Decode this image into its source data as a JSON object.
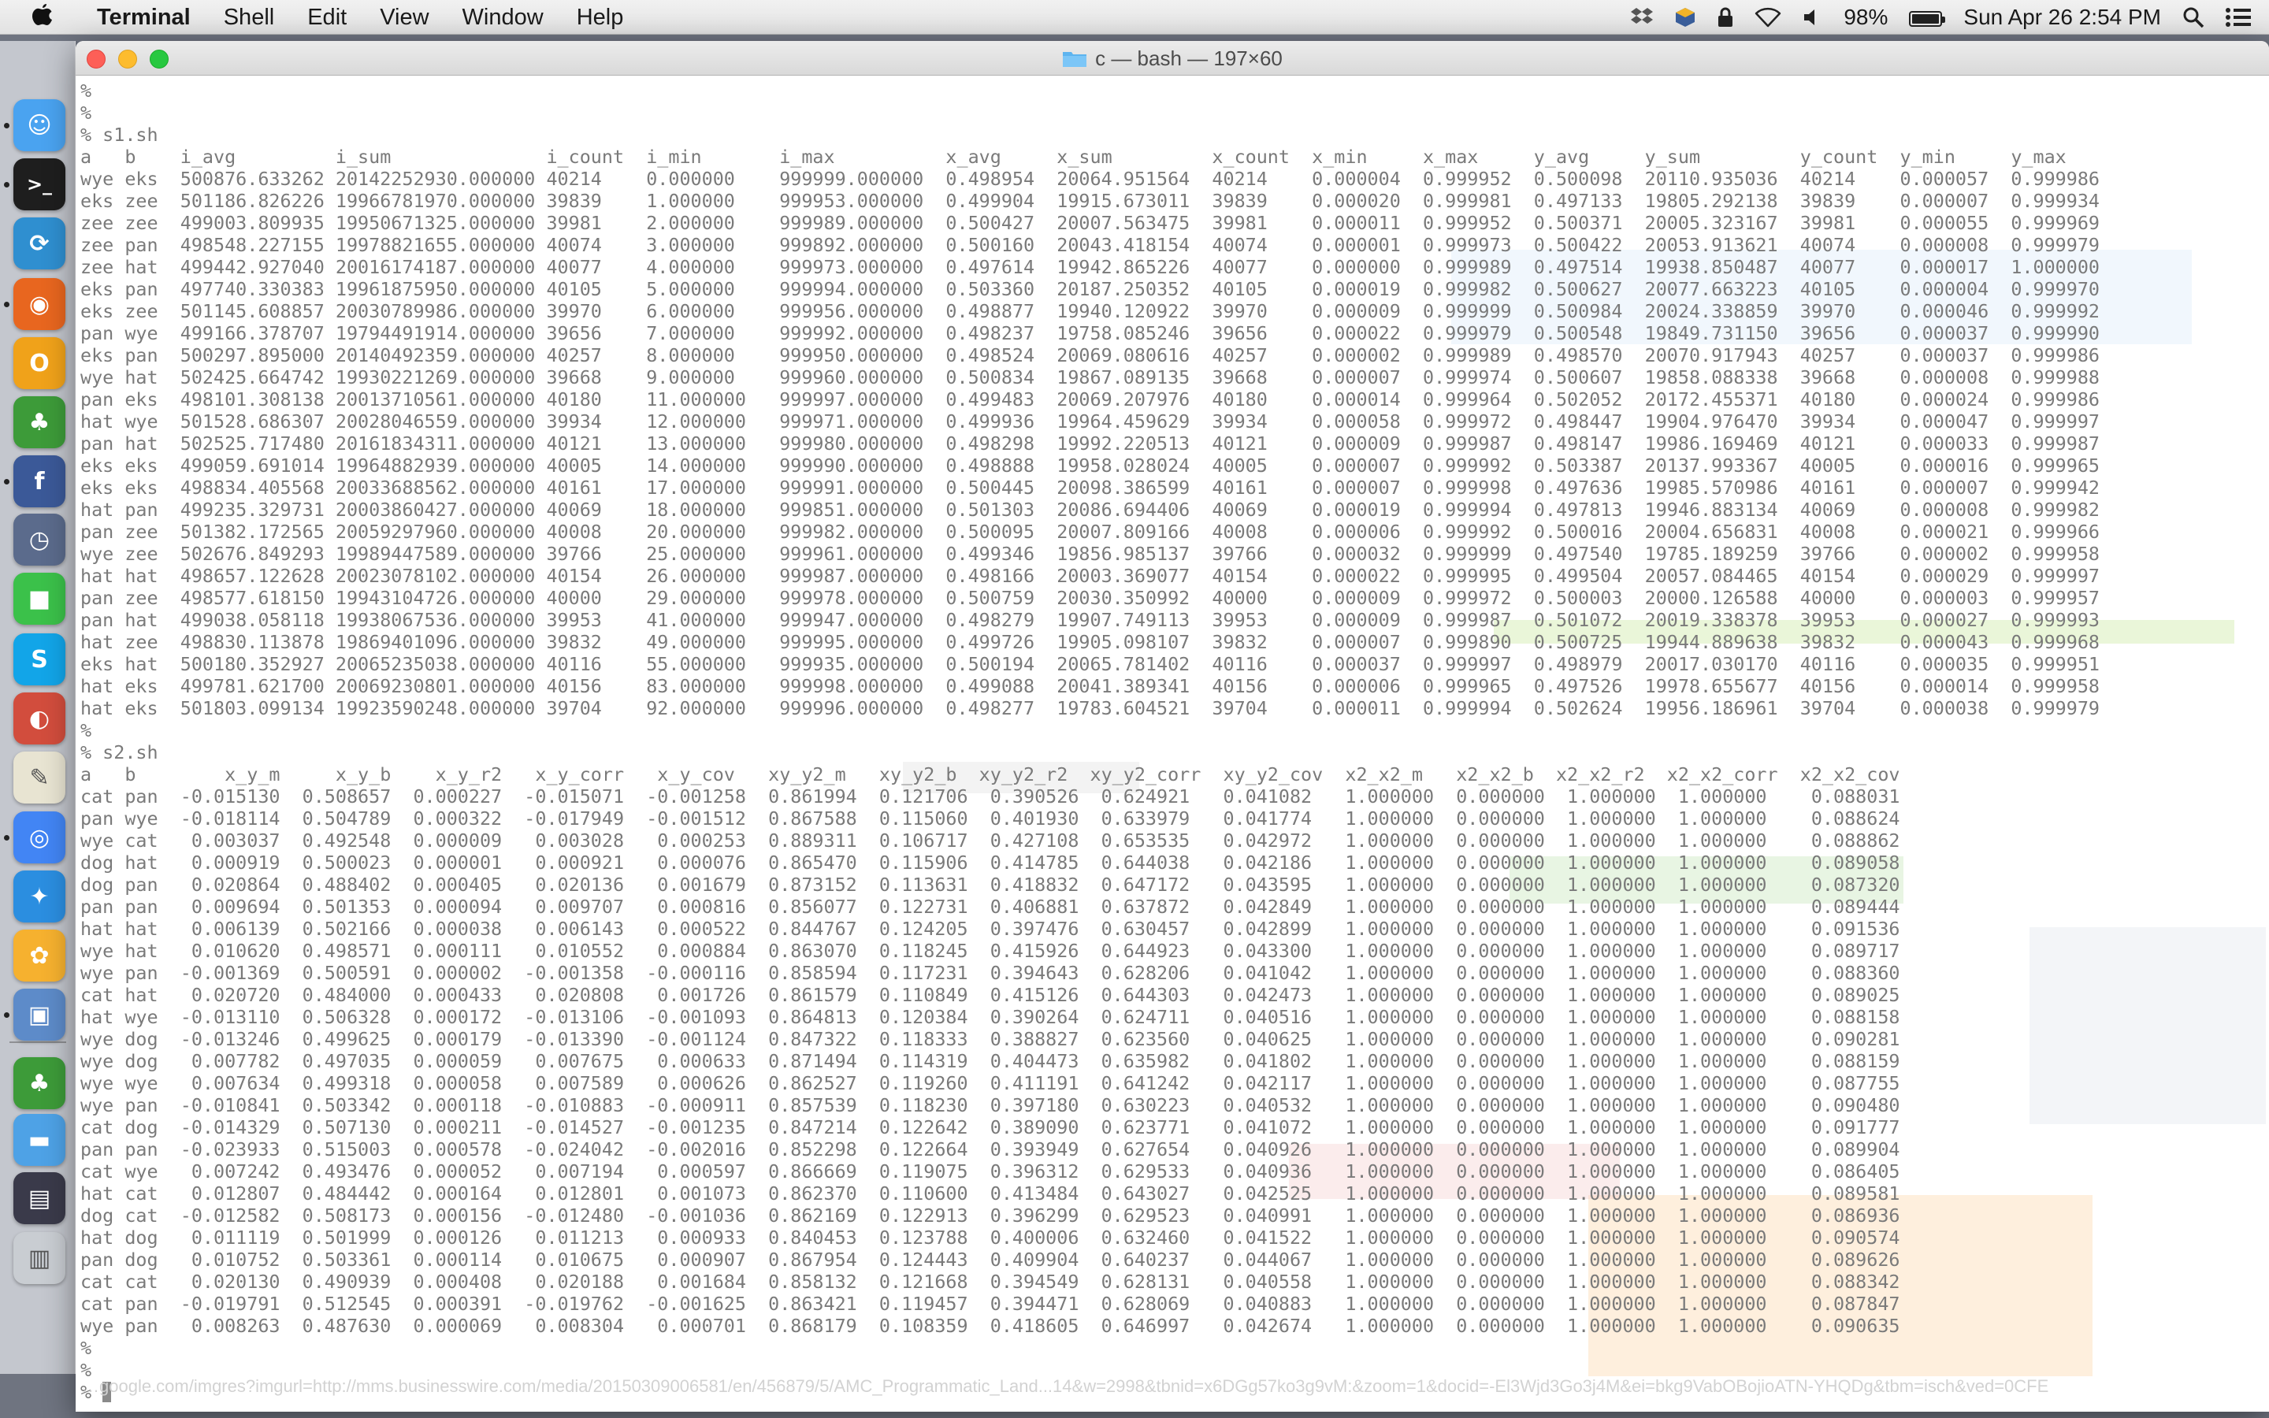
{
  "menubar": {
    "app": "Terminal",
    "items": [
      "Shell",
      "Edit",
      "View",
      "Window",
      "Help"
    ],
    "battery_percent": "98%",
    "battery_level": 0.98,
    "clock": "Sun Apr 26  2:54 PM"
  },
  "window": {
    "title": "c — bash — 197×60"
  },
  "terminal": {
    "lines": [
      "%",
      "%",
      "% s1.sh",
      "a   b    i_avg         i_sum              i_count  i_min       i_max          x_avg     x_sum         x_count  x_min     x_max     y_avg     y_sum         y_count  y_min     y_max",
      "wye eks  500876.633262 20142252930.000000 40214    0.000000    999999.000000  0.498954  20064.951564  40214    0.000004  0.999952  0.500098  20110.935036  40214    0.000057  0.999986",
      "eks zee  501186.826226 19966781970.000000 39839    1.000000    999953.000000  0.499904  19915.673011  39839    0.000020  0.999981  0.497133  19805.292138  39839    0.000007  0.999934",
      "zee zee  499003.809935 19950671325.000000 39981    2.000000    999989.000000  0.500427  20007.563475  39981    0.000011  0.999952  0.500371  20005.323167  39981    0.000055  0.999969",
      "zee pan  498548.227155 19978821655.000000 40074    3.000000    999892.000000  0.500160  20043.418154  40074    0.000001  0.999973  0.500422  20053.913621  40074    0.000008  0.999979",
      "zee hat  499442.927040 20016174187.000000 40077    4.000000    999973.000000  0.497614  19942.865226  40077    0.000000  0.999989  0.497514  19938.850487  40077    0.000017  1.000000",
      "eks pan  497740.330383 19961875950.000000 40105    5.000000    999994.000000  0.503360  20187.250352  40105    0.000019  0.999982  0.500627  20077.663223  40105    0.000004  0.999970",
      "eks zee  501145.608857 20030789986.000000 39970    6.000000    999956.000000  0.498877  19940.120922  39970    0.000009  0.999999  0.500984  20024.338859  39970    0.000046  0.999992",
      "pan wye  499166.378707 19794491914.000000 39656    7.000000    999992.000000  0.498237  19758.085246  39656    0.000022  0.999979  0.500548  19849.731150  39656    0.000037  0.999990",
      "eks pan  500297.895000 20140492359.000000 40257    8.000000    999950.000000  0.498524  20069.080616  40257    0.000002  0.999989  0.498570  20070.917943  40257    0.000037  0.999986",
      "wye hat  502425.664742 19930221269.000000 39668    9.000000    999960.000000  0.500834  19867.089135  39668    0.000007  0.999974  0.500607  19858.088338  39668    0.000008  0.999988",
      "pan eks  498101.308138 20013710561.000000 40180    11.000000   999997.000000  0.499483  20069.207976  40180    0.000014  0.999964  0.502052  20172.455371  40180    0.000024  0.999986",
      "hat wye  501528.686307 20028046559.000000 39934    12.000000   999971.000000  0.499936  19964.459629  39934    0.000058  0.999972  0.498447  19904.976470  39934    0.000047  0.999997",
      "pan hat  502525.717480 20161834311.000000 40121    13.000000   999980.000000  0.498298  19992.220513  40121    0.000009  0.999987  0.498147  19986.169469  40121    0.000033  0.999987",
      "eks eks  499059.691014 19964882939.000000 40005    14.000000   999990.000000  0.498888  19958.028024  40005    0.000007  0.999992  0.503387  20137.993367  40005    0.000016  0.999965",
      "eks eks  498834.405568 20033688562.000000 40161    17.000000   999991.000000  0.500445  20098.386599  40161    0.000007  0.999998  0.497636  19985.570986  40161    0.000007  0.999942",
      "hat pan  499235.329731 20003860427.000000 40069    18.000000   999851.000000  0.501303  20086.694406  40069    0.000019  0.999994  0.497813  19946.883134  40069    0.000008  0.999982",
      "pan zee  501382.172565 20059297960.000000 40008    20.000000   999982.000000  0.500095  20007.809166  40008    0.000006  0.999992  0.500016  20004.656831  40008    0.000021  0.999966",
      "wye zee  502676.849293 19989447589.000000 39766    25.000000   999961.000000  0.499346  19856.985137  39766    0.000032  0.999999  0.497540  19785.189259  39766    0.000002  0.999958",
      "hat hat  498657.122628 20023078102.000000 40154    26.000000   999987.000000  0.498166  20003.369077  40154    0.000022  0.999995  0.499504  20057.084465  40154    0.000029  0.999997",
      "pan zee  498577.618150 19943104726.000000 40000    29.000000   999978.000000  0.500759  20030.350992  40000    0.000009  0.999972  0.500003  20000.126588  40000    0.000003  0.999957",
      "pan hat  499038.058118 19938067536.000000 39953    41.000000   999947.000000  0.498279  19907.749113  39953    0.000009  0.999987  0.501072  20019.338378  39953    0.000027  0.999993",
      "hat zee  498830.113878 19869401096.000000 39832    49.000000   999995.000000  0.499726  19905.098107  39832    0.000007  0.999890  0.500725  19944.889638  39832    0.000043  0.999968",
      "eks hat  500180.352927 20065235038.000000 40116    55.000000   999935.000000  0.500194  20065.781402  40116    0.000037  0.999997  0.498979  20017.030170  40116    0.000035  0.999951",
      "hat eks  499781.621700 20069230801.000000 40156    83.000000   999998.000000  0.499088  20041.389341  40156    0.000006  0.999965  0.497526  19978.655677  40156    0.000014  0.999958",
      "hat eks  501803.099134 19923590248.000000 39704    92.000000   999996.000000  0.498277  19783.604521  39704    0.000011  0.999994  0.502624  19956.186961  39704    0.000038  0.999979",
      "%",
      "% s2.sh",
      "a   b        x_y_m     x_y_b    x_y_r2   x_y_corr   x_y_cov   xy_y2_m   xy_y2_b  xy_y2_r2  xy_y2_corr  xy_y2_cov  x2_x2_m   x2_x2_b  x2_x2_r2  x2_x2_corr  x2_x2_cov",
      "cat pan  -0.015130  0.508657  0.000227  -0.015071  -0.001258  0.861994  0.121706  0.390526  0.624921   0.041082   1.000000  0.000000  1.000000  1.000000    0.088031",
      "pan wye  -0.018114  0.504789  0.000322  -0.017949  -0.001512  0.867588  0.115060  0.401930  0.633979   0.041774   1.000000  0.000000  1.000000  1.000000    0.088624",
      "wye cat   0.003037  0.492548  0.000009   0.003028   0.000253  0.889311  0.106717  0.427108  0.653535   0.042972   1.000000  0.000000  1.000000  1.000000    0.088862",
      "dog hat   0.000919  0.500023  0.000001   0.000921   0.000076  0.865470  0.115906  0.414785  0.644038   0.042186   1.000000  0.000000  1.000000  1.000000    0.089058",
      "dog pan   0.020864  0.488402  0.000405   0.020136   0.001679  0.873152  0.113631  0.418832  0.647172   0.043595   1.000000  0.000000  1.000000  1.000000    0.087320",
      "pan pan   0.009694  0.501353  0.000094   0.009707   0.000816  0.856077  0.122731  0.406881  0.637872   0.042849   1.000000  0.000000  1.000000  1.000000    0.089444",
      "hat hat   0.006139  0.502166  0.000038   0.006143   0.000522  0.844767  0.124205  0.397476  0.630457   0.042899   1.000000  0.000000  1.000000  1.000000    0.091536",
      "wye hat   0.010620  0.498571  0.000111   0.010552   0.000884  0.863070  0.118245  0.415926  0.644923   0.043300   1.000000  0.000000  1.000000  1.000000    0.089717",
      "wye pan  -0.001369  0.500591  0.000002  -0.001358  -0.000116  0.858594  0.117231  0.394643  0.628206   0.041042   1.000000  0.000000  1.000000  1.000000    0.088360",
      "cat hat   0.020720  0.484000  0.000433   0.020808   0.001726  0.861579  0.110849  0.415126  0.644303   0.042473   1.000000  0.000000  1.000000  1.000000    0.089025",
      "hat wye  -0.013110  0.506328  0.000172  -0.013106  -0.001093  0.864813  0.120384  0.390264  0.624711   0.040516   1.000000  0.000000  1.000000  1.000000    0.088158",
      "wye dog  -0.013246  0.499625  0.000179  -0.013390  -0.001124  0.847322  0.118333  0.388827  0.623560   0.040625   1.000000  0.000000  1.000000  1.000000    0.090281",
      "wye dog   0.007782  0.497035  0.000059   0.007675   0.000633  0.871494  0.114319  0.404473  0.635982   0.041802   1.000000  0.000000  1.000000  1.000000    0.088159",
      "wye wye   0.007634  0.499318  0.000058   0.007589   0.000626  0.862527  0.119260  0.411191  0.641242   0.042117   1.000000  0.000000  1.000000  1.000000    0.087755",
      "wye pan  -0.010841  0.503342  0.000118  -0.010883  -0.000911  0.857539  0.118230  0.397180  0.630223   0.040532   1.000000  0.000000  1.000000  1.000000    0.090480",
      "cat dog  -0.014329  0.507130  0.000211  -0.014527  -0.001235  0.847214  0.122642  0.389090  0.623771   0.041072   1.000000  0.000000  1.000000  1.000000    0.091777",
      "pan pan  -0.023933  0.515003  0.000578  -0.024042  -0.002016  0.852298  0.122664  0.393949  0.627654   0.040926   1.000000  0.000000  1.000000  1.000000    0.089904",
      "cat wye   0.007242  0.493476  0.000052   0.007194   0.000597  0.866669  0.119075  0.396312  0.629533   0.040936   1.000000  0.000000  1.000000  1.000000    0.086405",
      "hat cat   0.012807  0.484442  0.000164   0.012801   0.001073  0.862370  0.110600  0.413484  0.643027   0.042525   1.000000  0.000000  1.000000  1.000000    0.089581",
      "dog cat  -0.012582  0.508173  0.000156  -0.012480  -0.001036  0.862169  0.122913  0.396299  0.629523   0.040991   1.000000  0.000000  1.000000  1.000000    0.086936",
      "hat dog   0.011119  0.501999  0.000126   0.011213   0.000933  0.840453  0.123788  0.400006  0.632460   0.041522   1.000000  0.000000  1.000000  1.000000    0.090574",
      "pan dog   0.010752  0.503361  0.000114   0.010675   0.000907  0.867954  0.124443  0.409904  0.640237   0.044067   1.000000  0.000000  1.000000  1.000000    0.089626",
      "cat cat   0.020130  0.490939  0.000408   0.020188   0.001684  0.858132  0.121668  0.394549  0.628131   0.040558   1.000000  0.000000  1.000000  1.000000    0.088342",
      "cat pan  -0.019791  0.512545  0.000391  -0.019762  -0.001625  0.863421  0.119457  0.394471  0.628069   0.040883   1.000000  0.000000  1.000000  1.000000    0.087847",
      "wye pan   0.008263  0.487630  0.000069   0.008304   0.000701  0.868179  0.108359  0.418605  0.646997   0.042674   1.000000  0.000000  1.000000  1.000000    0.090635",
      "%",
      "%"
    ],
    "prompt": "% "
  },
  "statusurl": "…google.com/imgres?imgurl=http://mms.businesswire.com/media/20150309006581/en/456879/5/AMC_Programmatic_Land...14&w=2998&tbnid=x6DGg57ko3g9vM:&zoom=1&docid=-El3Wjd3Go3j4M&ei=bkg9VabOBojioATN-YHQDg&tbm=isch&ved=0CFE",
  "dock": [
    {
      "icon": "finder-icon",
      "color": "#4aa3f0",
      "glyph": "☺",
      "running": true
    },
    {
      "icon": "terminal-icon",
      "color": "#1e1e1e",
      "glyph": ">_",
      "running": true
    },
    {
      "icon": "sync-icon",
      "color": "#2f8fd0",
      "glyph": "⟳",
      "running": false
    },
    {
      "icon": "firefox-icon",
      "color": "#e8661f",
      "glyph": "◉",
      "running": true
    },
    {
      "icon": "opera-icon",
      "color": "#f0a21a",
      "glyph": "O",
      "running": false
    },
    {
      "icon": "adium-icon",
      "color": "#3d9b39",
      "glyph": "♣",
      "running": false
    },
    {
      "icon": "facebook-icon",
      "color": "#3b5998",
      "glyph": "f",
      "running": true
    },
    {
      "icon": "alarm-clock-icon",
      "color": "#5b6b8c",
      "glyph": "◷",
      "running": false
    },
    {
      "icon": "facetime-icon",
      "color": "#3bc14a",
      "glyph": "■",
      "running": false
    },
    {
      "icon": "skype-icon",
      "color": "#12a5e8",
      "glyph": "S",
      "running": false
    },
    {
      "icon": "picasa-icon",
      "color": "#d24d3d",
      "glyph": "◐",
      "running": false
    },
    {
      "icon": "textedit-icon",
      "color": "#e8e4d2",
      "glyph": "✎",
      "running": false
    },
    {
      "icon": "chrome-icon",
      "color": "#4285f4",
      "glyph": "◎",
      "running": true
    },
    {
      "icon": "safari-icon",
      "color": "#2b8ee0",
      "glyph": "✦",
      "running": false
    },
    {
      "icon": "photos-icon",
      "color": "#f6b12f",
      "glyph": "✿",
      "running": false
    },
    {
      "icon": "preview-icon",
      "color": "#5d8bc9",
      "glyph": "▣",
      "running": true
    },
    {
      "icon": "adium-duck-icon",
      "color": "#3d9b39",
      "glyph": "♣",
      "running": false
    },
    {
      "icon": "folder-icon",
      "color": "#4ea2e6",
      "glyph": "▬",
      "running": false
    },
    {
      "icon": "downloads-stack-icon",
      "color": "#3a3a4a",
      "glyph": "▤",
      "running": false
    },
    {
      "icon": "trash-icon",
      "color": "#c9cdd2",
      "glyph": "▥",
      "running": false
    }
  ]
}
